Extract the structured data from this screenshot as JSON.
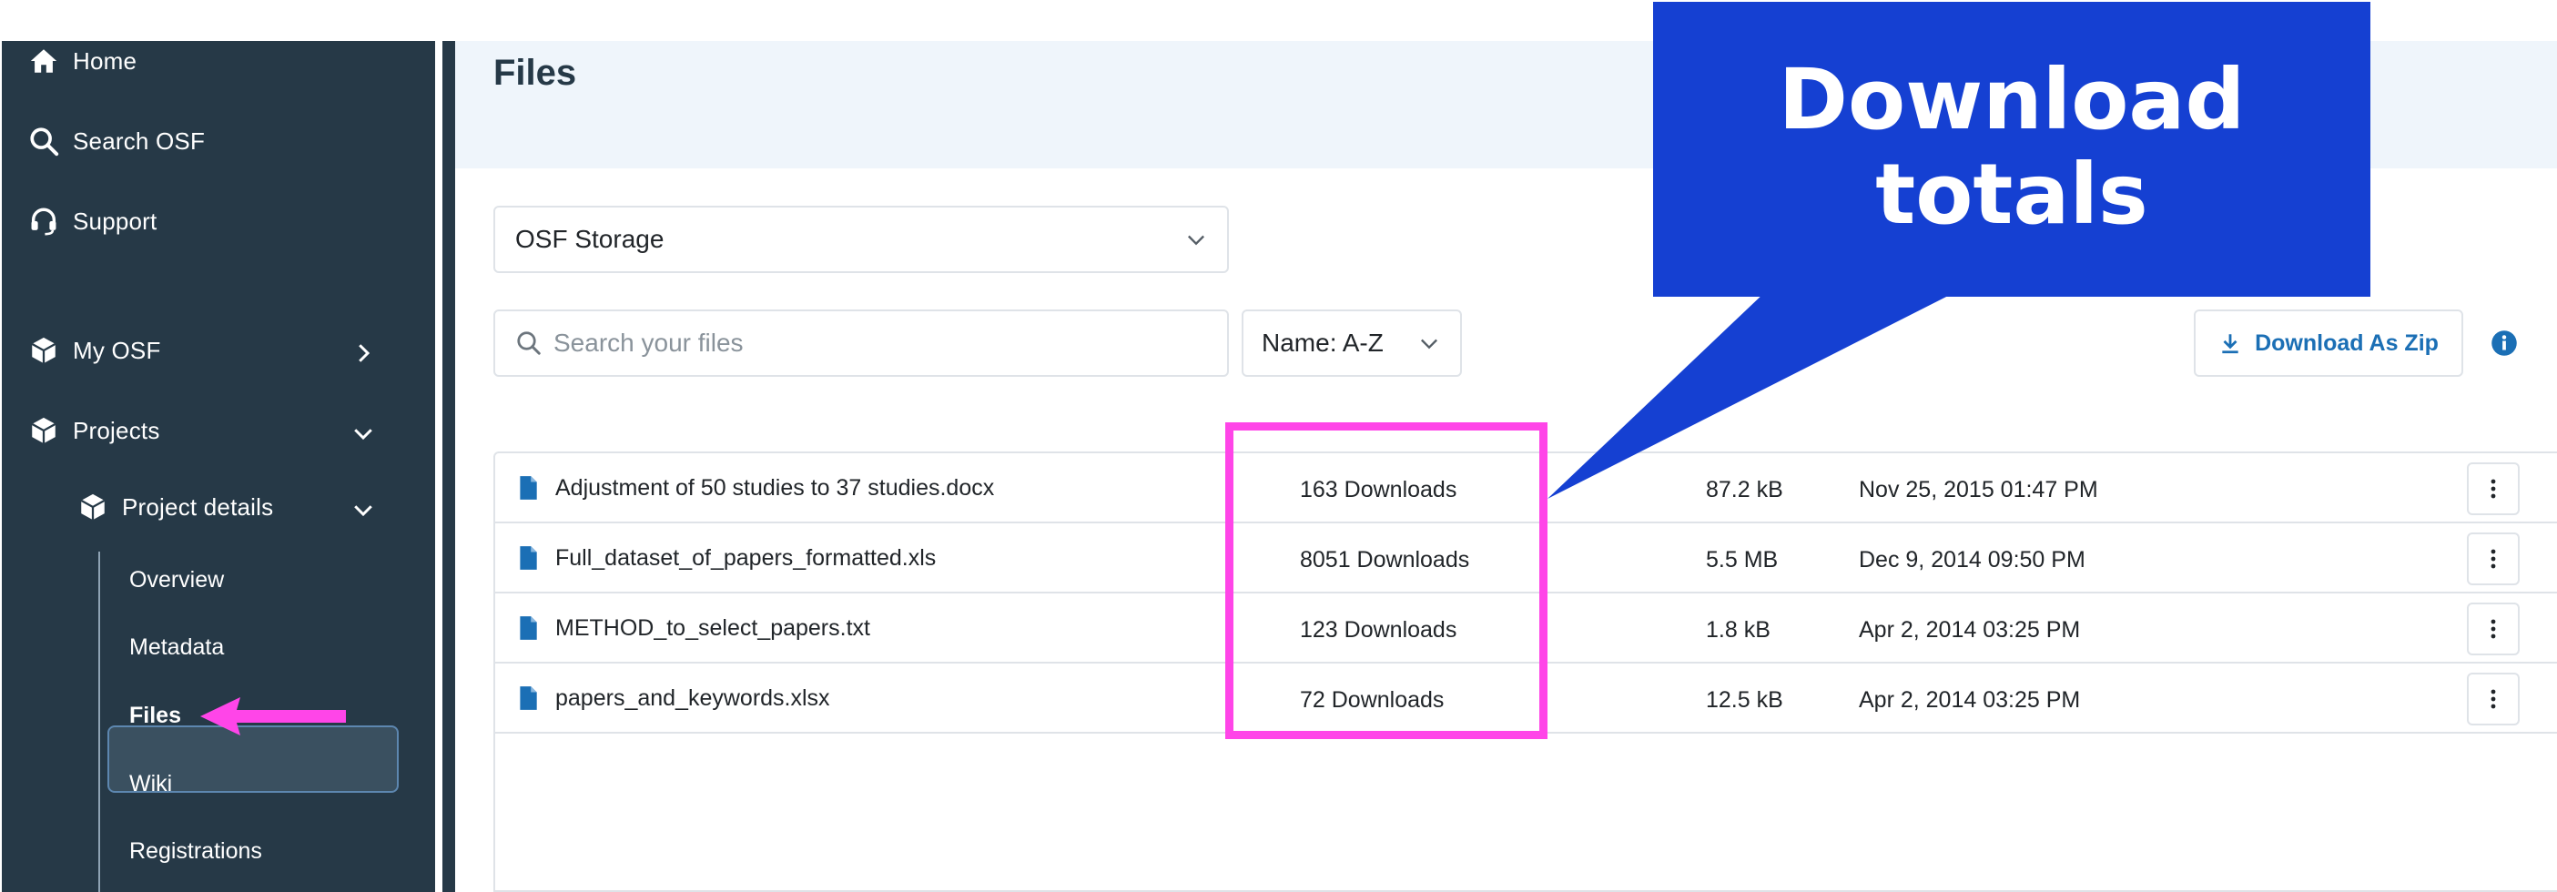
{
  "sidebar": {
    "home": "Home",
    "search": "Search OSF",
    "support": "Support",
    "my_osf": "My OSF",
    "projects": "Projects",
    "project_details": "Project details",
    "subitems": [
      "Overview",
      "Metadata",
      "Files",
      "Wiki",
      "Registrations"
    ],
    "active_subitem": "Files"
  },
  "main": {
    "title": "Files",
    "storage_select": "OSF Storage",
    "search_placeholder": "Search your files",
    "sort_select": "Name: A-Z",
    "download_zip": "Download As Zip"
  },
  "files": [
    {
      "name": "Adjustment of 50 studies to 37 studies.docx",
      "downloads": "163 Downloads",
      "size": "87.2 kB",
      "date": "Nov 25, 2015 01:47 PM"
    },
    {
      "name": "Full_dataset_of_papers_formatted.xls",
      "downloads": "8051 Downloads",
      "size": "5.5 MB",
      "date": "Dec 9, 2014 09:50 PM"
    },
    {
      "name": "METHOD_to_select_papers.txt",
      "downloads": "123 Downloads",
      "size": "1.8 kB",
      "date": "Apr 2, 2014 03:25 PM"
    },
    {
      "name": "papers_and_keywords.xlsx",
      "downloads": "72 Downloads",
      "size": "12.5 kB",
      "date": "Apr 2, 2014 03:25 PM"
    }
  ],
  "annotation": {
    "callout_line1": "Download",
    "callout_line2": "totals"
  },
  "colors": {
    "sidebar": "#263947",
    "accent": "#1b6fb5",
    "highlight": "#ff45e8",
    "callout": "#1540d2"
  }
}
